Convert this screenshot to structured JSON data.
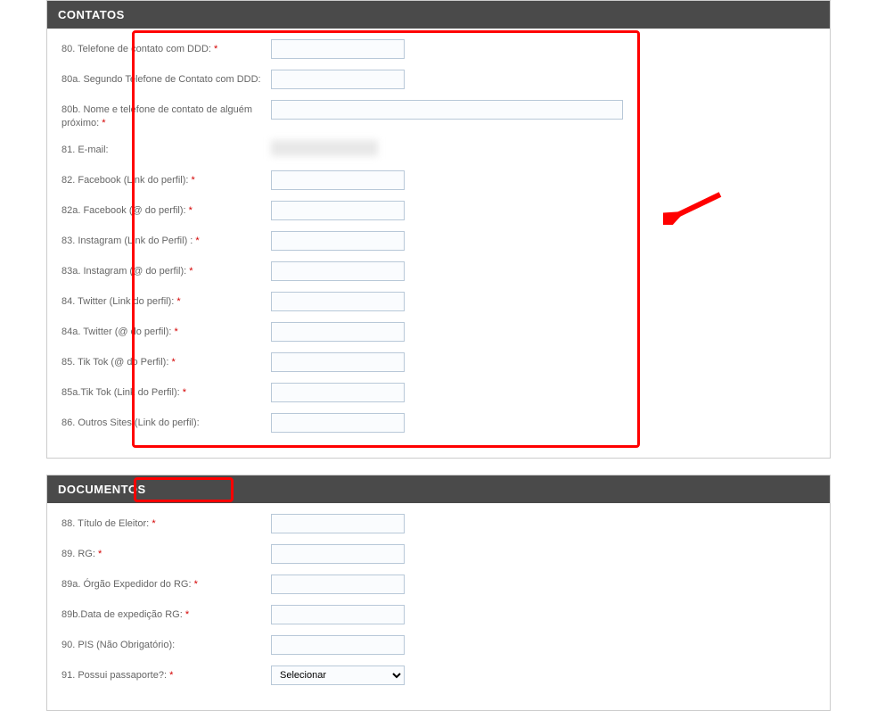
{
  "sections": {
    "contatos": {
      "title": "CONTATOS",
      "fields": [
        {
          "label": "80. Telefone de contato com DDD:",
          "required": true,
          "type": "text",
          "value": "",
          "width": "normal"
        },
        {
          "label": "80a. Segundo Telefone de Contato com DDD:",
          "required": false,
          "type": "text",
          "value": "",
          "width": "normal"
        },
        {
          "label": "80b. Nome e telefone de contato de alguém próximo:",
          "required": true,
          "type": "text",
          "value": "",
          "width": "wide"
        },
        {
          "label": "81. E-mail:",
          "required": false,
          "type": "blurred",
          "value": "",
          "width": "normal"
        },
        {
          "label": "82. Facebook (Link do perfil):",
          "required": true,
          "type": "text",
          "value": "",
          "width": "normal"
        },
        {
          "label": "82a. Facebook (@ do perfil):",
          "required": true,
          "type": "text",
          "value": "",
          "width": "normal"
        },
        {
          "label": "83. Instagram (Link do Perfil) :",
          "required": true,
          "type": "text",
          "value": "",
          "width": "normal"
        },
        {
          "label": "83a. Instagram (@ do perfil):",
          "required": true,
          "type": "text",
          "value": "",
          "width": "normal"
        },
        {
          "label": "84. Twitter (Link do perfil):",
          "required": true,
          "type": "text",
          "value": "",
          "width": "normal"
        },
        {
          "label": "84a. Twitter (@ do perfil):",
          "required": true,
          "type": "text",
          "value": "",
          "width": "normal"
        },
        {
          "label": "85. Tik Tok (@ do Perfil):",
          "required": true,
          "type": "text",
          "value": "",
          "width": "normal"
        },
        {
          "label": "85a.Tik Tok (Link do Perfil):",
          "required": true,
          "type": "text",
          "value": "",
          "width": "normal"
        },
        {
          "label": "86. Outros Sites (Link do perfil):",
          "required": false,
          "type": "text",
          "value": "",
          "width": "normal"
        }
      ]
    },
    "documentos": {
      "title": "DOCUMENTOS",
      "fields": [
        {
          "label": "88. Título de Eleitor:",
          "required": true,
          "type": "text",
          "value": "",
          "width": "normal"
        },
        {
          "label": "89. RG:",
          "required": true,
          "type": "text",
          "value": "",
          "width": "normal"
        },
        {
          "label": "89a. Órgão Expedidor do RG:",
          "required": true,
          "type": "text",
          "value": "",
          "width": "normal"
        },
        {
          "label": "89b.Data de expedição RG:",
          "required": true,
          "type": "text",
          "value": "",
          "width": "normal"
        },
        {
          "label": "90. PIS (Não Obrigatório):",
          "required": false,
          "type": "text",
          "value": "",
          "width": "normal"
        },
        {
          "label": "91. Possui passaporte?:",
          "required": true,
          "type": "select",
          "value": "Selecionar",
          "width": "normal"
        }
      ]
    }
  },
  "select_placeholder": "Selecionar",
  "required_marker": "*"
}
